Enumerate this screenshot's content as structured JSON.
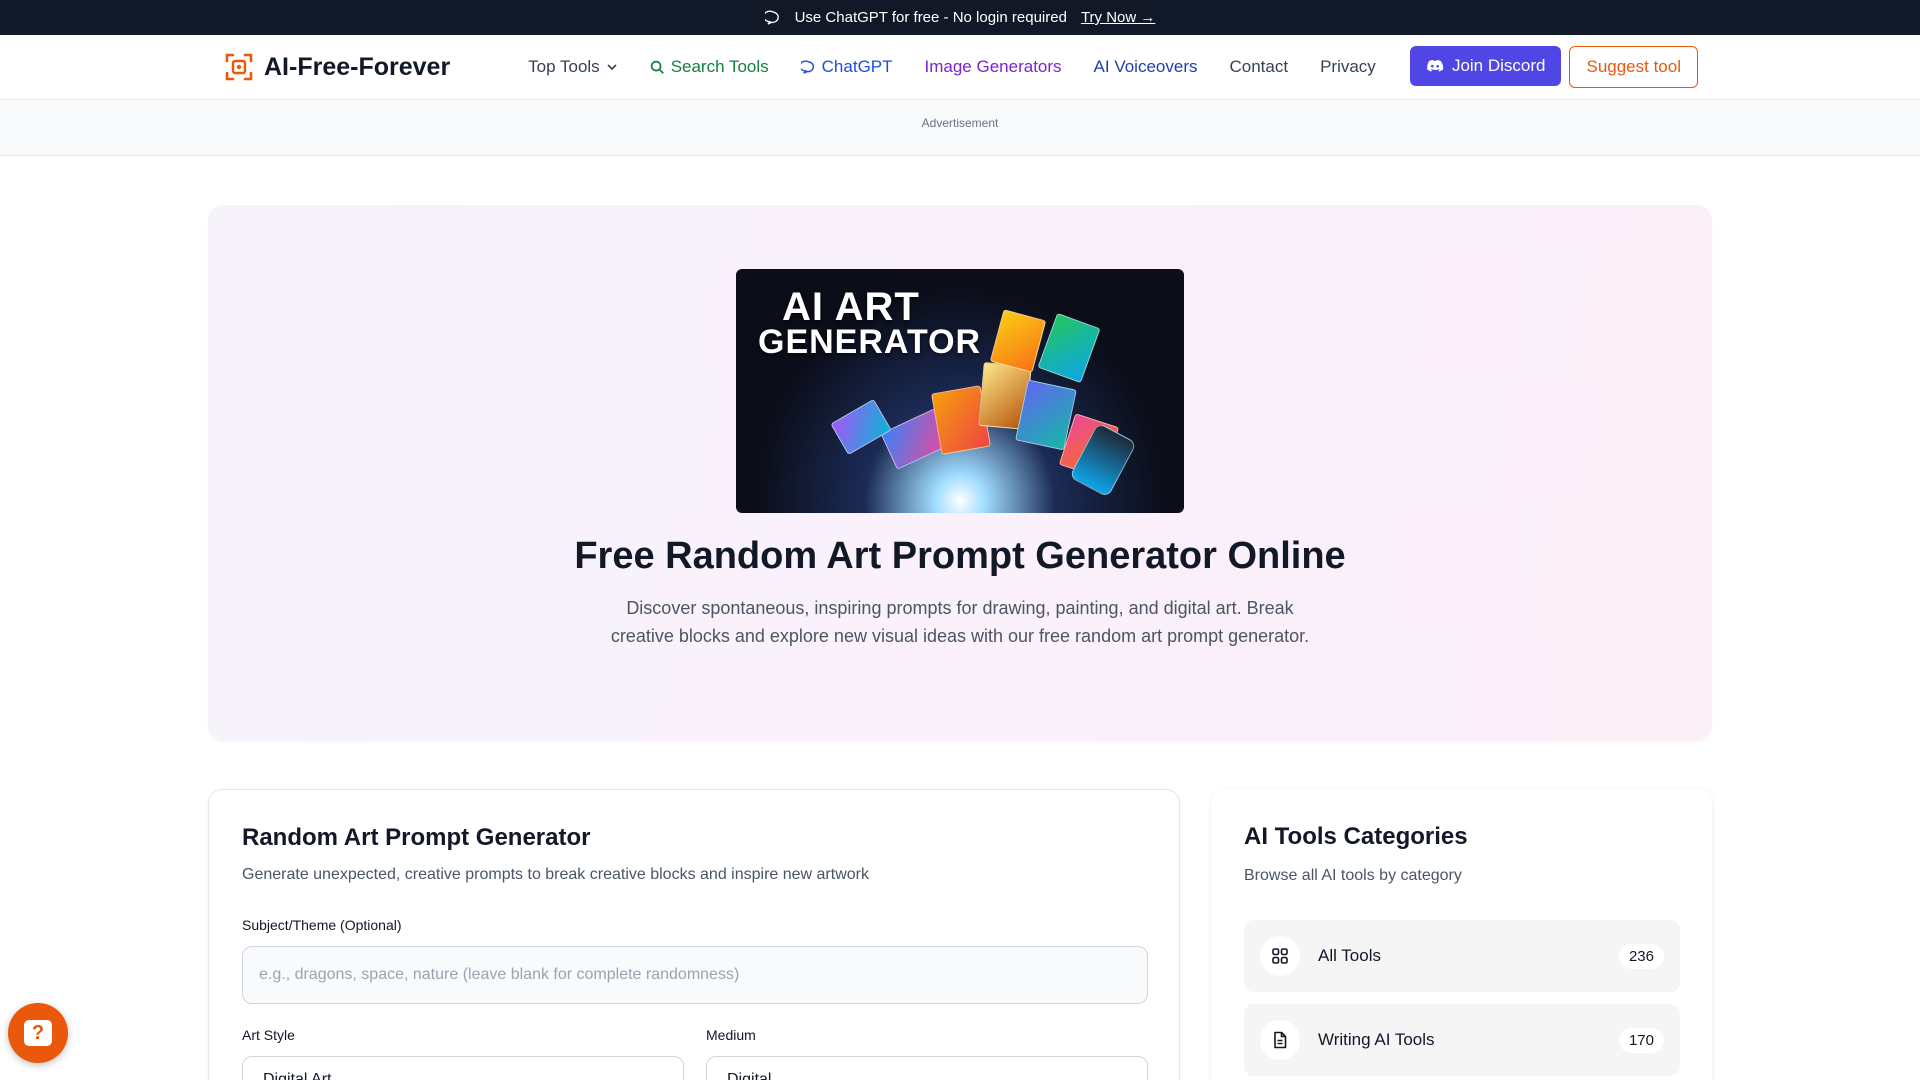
{
  "topbar": {
    "message": "Use ChatGPT for free - No login required",
    "cta": "Try Now →"
  },
  "nav": {
    "brand": "AI-Free-Forever",
    "links": [
      {
        "label": "Top Tools",
        "icon": "chevron-down-icon"
      },
      {
        "label": "Search Tools",
        "icon": "search-icon"
      },
      {
        "label": "ChatGPT",
        "icon": "chat-bubble-icon"
      },
      {
        "label": "Image Generators"
      },
      {
        "label": "AI Voiceovers"
      },
      {
        "label": "Contact"
      },
      {
        "label": "Privacy"
      }
    ],
    "discord_button": "Join Discord",
    "suggest_button": "Suggest tool"
  },
  "ad": {
    "label": "Advertisement"
  },
  "hero": {
    "image_title_line1": "AI ART",
    "image_title_line2": "GENERATOR",
    "title": "Free Random Art Prompt Generator Online",
    "description": "Discover spontaneous, inspiring prompts for drawing, painting, and digital art. Break creative blocks and explore new visual ideas with our free random art prompt generator."
  },
  "generator": {
    "title": "Random Art Prompt Generator",
    "subtitle": "Generate unexpected, creative prompts to break creative blocks and inspire new artwork",
    "subject_label": "Subject/Theme (Optional)",
    "subject_placeholder": "e.g., dragons, space, nature (leave blank for complete randomness)",
    "style_label": "Art Style",
    "style_value": "Digital Art",
    "medium_label": "Medium",
    "medium_value": "Digital"
  },
  "categories": {
    "title": "AI Tools Categories",
    "subtitle": "Browse all AI tools by category",
    "items": [
      {
        "label": "All Tools",
        "count": "236",
        "icon": "grid-icon"
      },
      {
        "label": "Writing AI Tools",
        "count": "170",
        "icon": "document-icon"
      }
    ]
  },
  "colors": {
    "accent_orange": "#ea580c",
    "discord_indigo": "#4f46e5",
    "topbar_dark": "#111827"
  }
}
